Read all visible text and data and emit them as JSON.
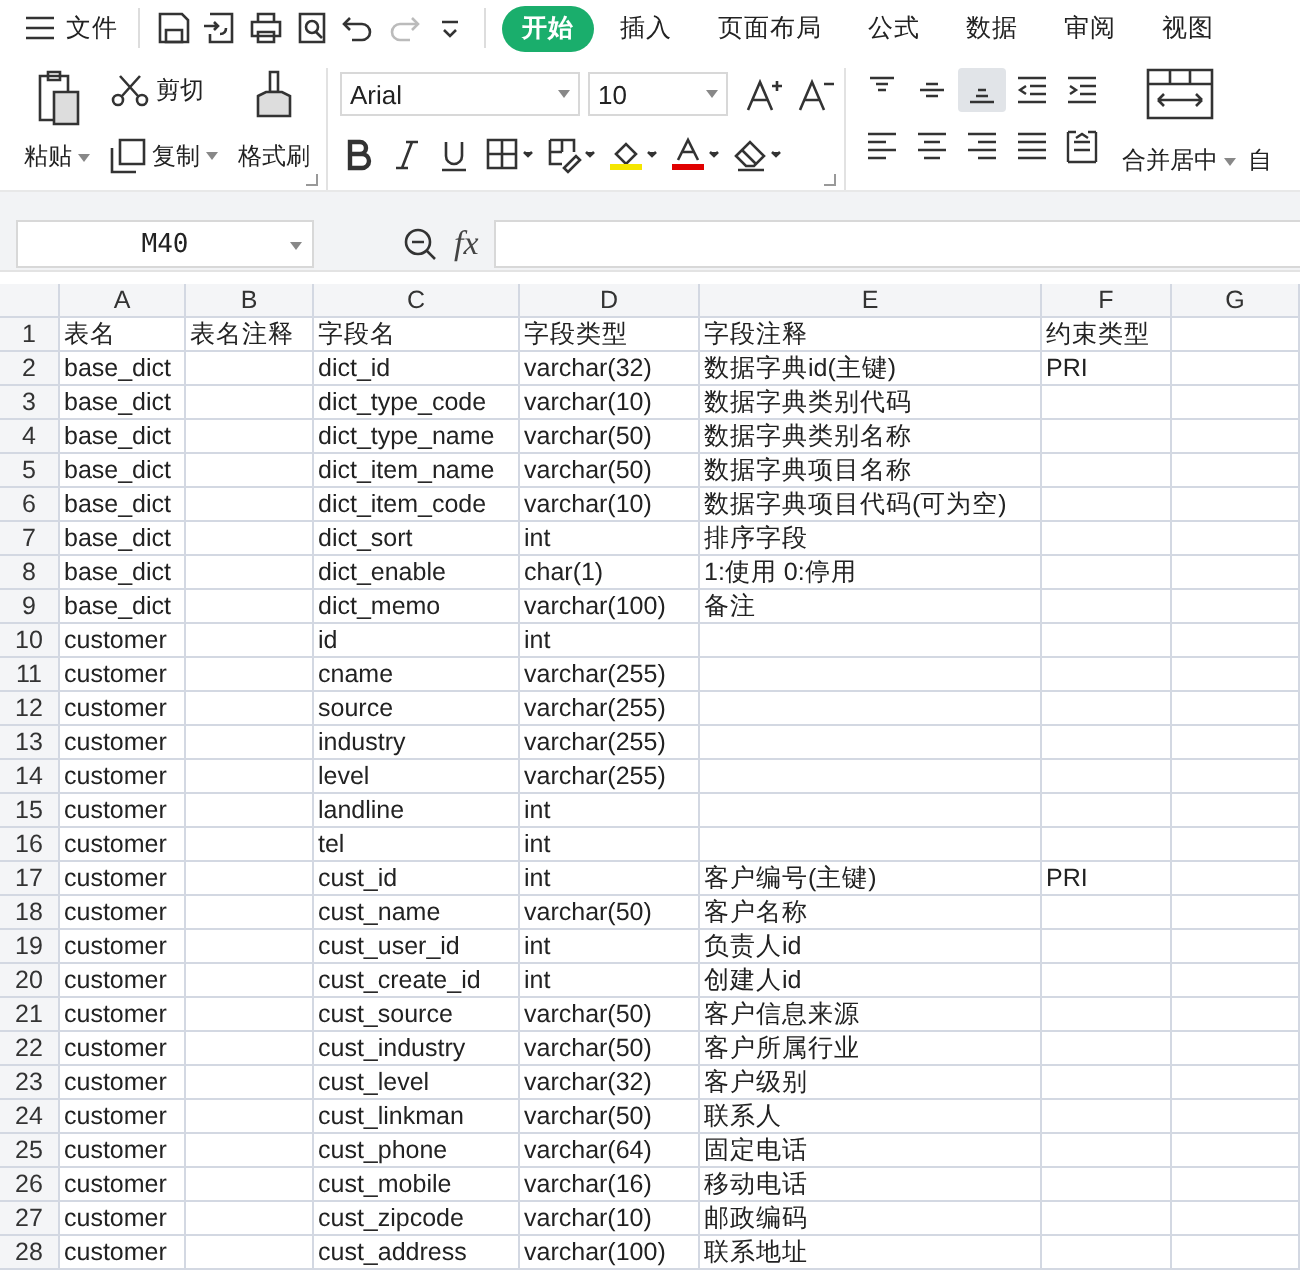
{
  "menu": {
    "label": "文件"
  },
  "quick_access": [
    {
      "kind": "save",
      "disabled": false
    },
    {
      "kind": "export",
      "disabled": false
    },
    {
      "kind": "print",
      "disabled": false
    },
    {
      "kind": "preview",
      "disabled": false
    },
    {
      "kind": "undo",
      "disabled": false
    },
    {
      "kind": "redo",
      "disabled": true
    },
    {
      "kind": "more",
      "disabled": false
    }
  ],
  "tabs": [
    {
      "label": "开始",
      "selected": true
    },
    {
      "label": "插入",
      "selected": false
    },
    {
      "label": "页面布局",
      "selected": false
    },
    {
      "label": "公式",
      "selected": false
    },
    {
      "label": "数据",
      "selected": false
    },
    {
      "label": "审阅",
      "selected": false
    },
    {
      "label": "视图",
      "selected": false
    }
  ],
  "ribbon": {
    "paste": "粘贴",
    "cut": "剪切",
    "copy": "复制",
    "format_painter": "格式刷",
    "font": "Arial",
    "font_size": "10",
    "size_buttons": [
      {
        "kind": "grow"
      },
      {
        "kind": "shrink"
      }
    ],
    "format_buttons": [
      {
        "kind": "bold"
      },
      {
        "kind": "italic"
      },
      {
        "kind": "underline"
      },
      {
        "kind": "borders"
      },
      {
        "kind": "cell-format"
      },
      {
        "kind": "fill-color"
      },
      {
        "kind": "font-color"
      },
      {
        "kind": "clear"
      }
    ],
    "align_buttons": [
      {
        "kind": "top",
        "selected": false
      },
      {
        "kind": "middle",
        "selected": false
      },
      {
        "kind": "bottom",
        "selected": true
      },
      {
        "kind": "outdent",
        "selected": false
      },
      {
        "kind": "indent",
        "selected": false
      },
      {
        "kind": "left",
        "selected": false
      },
      {
        "kind": "center",
        "selected": false
      },
      {
        "kind": "right",
        "selected": false
      },
      {
        "kind": "justify",
        "selected": false
      },
      {
        "kind": "distributed",
        "selected": false
      }
    ],
    "merge": "合并居中",
    "wrap": "自"
  },
  "formula_bar": {
    "cell_name": "M40",
    "function_label": "fx"
  },
  "grid": {
    "columns": [
      "A",
      "B",
      "C",
      "D",
      "E",
      "F",
      "G"
    ],
    "rows": [
      {
        "n": "1",
        "cells": {
          "A": "表名",
          "B": "表名注释",
          "C": "字段名",
          "D": "字段类型",
          "E": "字段注释",
          "F": "约束类型"
        }
      },
      {
        "n": "2",
        "cells": {
          "A": "base_dict",
          "C": "dict_id",
          "D": "varchar(32)",
          "E": "数据字典id(主键)",
          "F": "PRI"
        }
      },
      {
        "n": "3",
        "cells": {
          "A": "base_dict",
          "C": "dict_type_code",
          "D": "varchar(10)",
          "E": "数据字典类别代码"
        }
      },
      {
        "n": "4",
        "cells": {
          "A": "base_dict",
          "C": "dict_type_name",
          "D": "varchar(50)",
          "E": "数据字典类别名称"
        }
      },
      {
        "n": "5",
        "cells": {
          "A": "base_dict",
          "C": "dict_item_name",
          "D": "varchar(50)",
          "E": "数据字典项目名称"
        }
      },
      {
        "n": "6",
        "cells": {
          "A": "base_dict",
          "C": "dict_item_code",
          "D": "varchar(10)",
          "E": "数据字典项目代码(可为空)"
        }
      },
      {
        "n": "7",
        "cells": {
          "A": "base_dict",
          "C": "dict_sort",
          "D": "int",
          "E": "排序字段"
        }
      },
      {
        "n": "8",
        "cells": {
          "A": "base_dict",
          "C": "dict_enable",
          "D": "char(1)",
          "E": "1:使用 0:停用"
        }
      },
      {
        "n": "9",
        "cells": {
          "A": "base_dict",
          "C": "dict_memo",
          "D": "varchar(100)",
          "E": "备注"
        }
      },
      {
        "n": "10",
        "cells": {
          "A": "customer",
          "C": "id",
          "D": "int"
        }
      },
      {
        "n": "11",
        "cells": {
          "A": "customer",
          "C": "cname",
          "D": "varchar(255)"
        }
      },
      {
        "n": "12",
        "cells": {
          "A": "customer",
          "C": "source",
          "D": "varchar(255)"
        }
      },
      {
        "n": "13",
        "cells": {
          "A": "customer",
          "C": "industry",
          "D": "varchar(255)"
        }
      },
      {
        "n": "14",
        "cells": {
          "A": "customer",
          "C": "level",
          "D": "varchar(255)"
        }
      },
      {
        "n": "15",
        "cells": {
          "A": "customer",
          "C": "landline",
          "D": "int"
        }
      },
      {
        "n": "16",
        "cells": {
          "A": "customer",
          "C": "tel",
          "D": "int"
        }
      },
      {
        "n": "17",
        "cells": {
          "A": "customer",
          "C": "cust_id",
          "D": "int",
          "E": "客户编号(主键)",
          "F": "PRI"
        }
      },
      {
        "n": "18",
        "cells": {
          "A": "customer",
          "C": "cust_name",
          "D": "varchar(50)",
          "E": "客户名称"
        }
      },
      {
        "n": "19",
        "cells": {
          "A": "customer",
          "C": "cust_user_id",
          "D": "int",
          "E": "负责人id"
        }
      },
      {
        "n": "20",
        "cells": {
          "A": "customer",
          "C": "cust_create_id",
          "D": "int",
          "E": "创建人id"
        }
      },
      {
        "n": "21",
        "cells": {
          "A": "customer",
          "C": "cust_source",
          "D": "varchar(50)",
          "E": "客户信息来源"
        }
      },
      {
        "n": "22",
        "cells": {
          "A": "customer",
          "C": "cust_industry",
          "D": "varchar(50)",
          "E": "客户所属行业"
        }
      },
      {
        "n": "23",
        "cells": {
          "A": "customer",
          "C": "cust_level",
          "D": "varchar(32)",
          "E": "客户级别"
        }
      },
      {
        "n": "24",
        "cells": {
          "A": "customer",
          "C": "cust_linkman",
          "D": "varchar(50)",
          "E": "联系人"
        }
      },
      {
        "n": "25",
        "cells": {
          "A": "customer",
          "C": "cust_phone",
          "D": "varchar(64)",
          "E": "固定电话"
        }
      },
      {
        "n": "26",
        "cells": {
          "A": "customer",
          "C": "cust_mobile",
          "D": "varchar(16)",
          "E": "移动电话"
        }
      },
      {
        "n": "27",
        "cells": {
          "A": "customer",
          "C": "cust_zipcode",
          "D": "varchar(10)",
          "E": "邮政编码"
        }
      },
      {
        "n": "28",
        "cells": {
          "A": "customer",
          "C": "cust_address",
          "D": "varchar(100)",
          "E": "联系地址"
        }
      }
    ]
  }
}
